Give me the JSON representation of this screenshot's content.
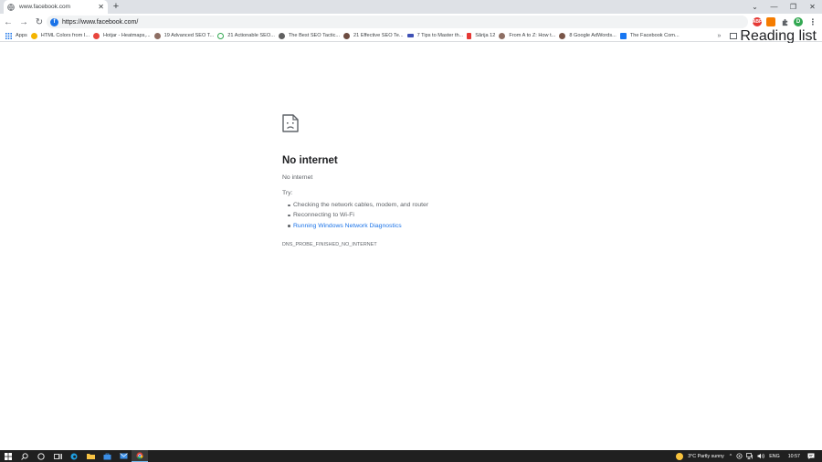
{
  "tab": {
    "title": "www.facebook.com",
    "close": "✕",
    "new_tab": "+"
  },
  "window_controls": {
    "dropdown": "⌄",
    "minimize": "—",
    "restore": "❐",
    "close": "✕"
  },
  "toolbar": {
    "back": "←",
    "forward": "→",
    "reload": "↻",
    "url": "https://www.facebook.com/",
    "menu": "⋮",
    "profile_initial": "D"
  },
  "bookmarks": [
    {
      "label": "Apps",
      "color": "#5f6368"
    },
    {
      "label": "HTML Colors from I...",
      "color": "#f4b400"
    },
    {
      "label": "Hotjar - Heatmaps,...",
      "color": "#e8453c"
    },
    {
      "label": "19 Advanced SEO T...",
      "color": "#8d6e63"
    },
    {
      "label": "21 Actionable SEO...",
      "color": "#34a853"
    },
    {
      "label": "The Best SEO Tactic...",
      "color": "#616161"
    },
    {
      "label": "21 Effective SEO Te...",
      "color": "#6d4c41"
    },
    {
      "label": "7 Tips to Master th...",
      "color": "#3f51b5"
    },
    {
      "label": "Sărija 12",
      "color": "#e53935"
    },
    {
      "label": "From A to Z: How t...",
      "color": "#8d6e63"
    },
    {
      "label": "8 Google AdWords...",
      "color": "#795548"
    },
    {
      "label": "The Facebook Com...",
      "color": "#1877f2"
    }
  ],
  "bookmarks_more": "»",
  "reading_list": "Reading list",
  "error": {
    "heading": "No internet",
    "subheading": "No internet",
    "try_label": "Try:",
    "suggestions": [
      "Checking the network cables, modem, and router",
      "Reconnecting to Wi-Fi"
    ],
    "diagnostics_link": "Running Windows Network Diagnostics",
    "code": "DNS_PROBE_FINISHED_NO_INTERNET"
  },
  "taskbar": {
    "weather": "3°C  Partly sunny",
    "language": "ENG",
    "time": "10:57"
  },
  "colors": {
    "accent": "#1a73e8",
    "tabstrip": "#dee1e6",
    "taskbar": "#202020"
  }
}
